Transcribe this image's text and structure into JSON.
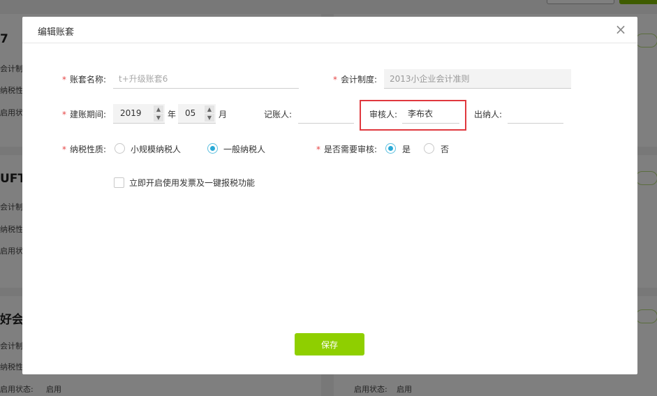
{
  "background": {
    "card1_title": "7",
    "card1_lines": [
      "会计制度",
      "纳税性质",
      "启用状态"
    ],
    "card2_title": "UFTD",
    "card2_lines": [
      "会计制度",
      "纳税性质",
      "启用状态"
    ],
    "card3_title": "好会计",
    "card3_lines": [
      "会计制度",
      "纳税性质"
    ],
    "status_label_left": "启用状态:",
    "status_value_left": "启用",
    "status_label_right": "启用状态:",
    "status_value_right": "启用"
  },
  "modal": {
    "title": "编辑账套",
    "close_symbol": "×",
    "account_name": {
      "label": "账套名称:",
      "value": "",
      "placeholder": "t+升级账套6"
    },
    "accounting_system": {
      "label": "会计制度:",
      "value": "2013小企业会计准则"
    },
    "start_period": {
      "label": "建账期间:",
      "year": "2019",
      "year_unit": "年",
      "month": "05",
      "month_unit": "月"
    },
    "bookkeeper": {
      "label": "记账人:",
      "value": ""
    },
    "reviewer": {
      "label": "审核人:",
      "value": "李布衣"
    },
    "cashier": {
      "label": "出纳人:",
      "value": ""
    },
    "tax_type": {
      "label": "纳税性质:",
      "options": [
        "小规模纳税人",
        "一般纳税人"
      ],
      "selected": "一般纳税人"
    },
    "need_review": {
      "label": "是否需要审核:",
      "options": [
        "是",
        "否"
      ],
      "selected": "是"
    },
    "invoice_feature": {
      "label": "立即开启使用发票及一键报税功能",
      "checked": false
    },
    "save_label": "保存",
    "required_mark": "*",
    "arrow_up": "▲",
    "arrow_down": "▼"
  },
  "colors": {
    "accent": "#8fcf00",
    "radio": "#2aa9d6",
    "required": "#e64545",
    "highlight": "#e0383e"
  }
}
